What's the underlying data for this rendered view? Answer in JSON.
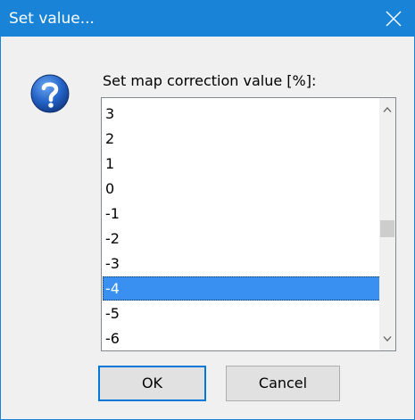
{
  "window": {
    "title": "Set value...",
    "close_icon": "close-icon",
    "question_icon": "question-icon"
  },
  "prompt": {
    "label": "Set map correction value [%]:"
  },
  "listbox": {
    "items": [
      "3",
      "2",
      "1",
      "0",
      "-1",
      "-2",
      "-3",
      "-4",
      "-5",
      "-6"
    ],
    "selected": "-4"
  },
  "buttons": {
    "ok_label": "OK",
    "cancel_label": "Cancel"
  },
  "colors": {
    "titlebar": "#1883d7",
    "selection": "#3990f0",
    "question_icon_blue": "#1a5fb4"
  }
}
